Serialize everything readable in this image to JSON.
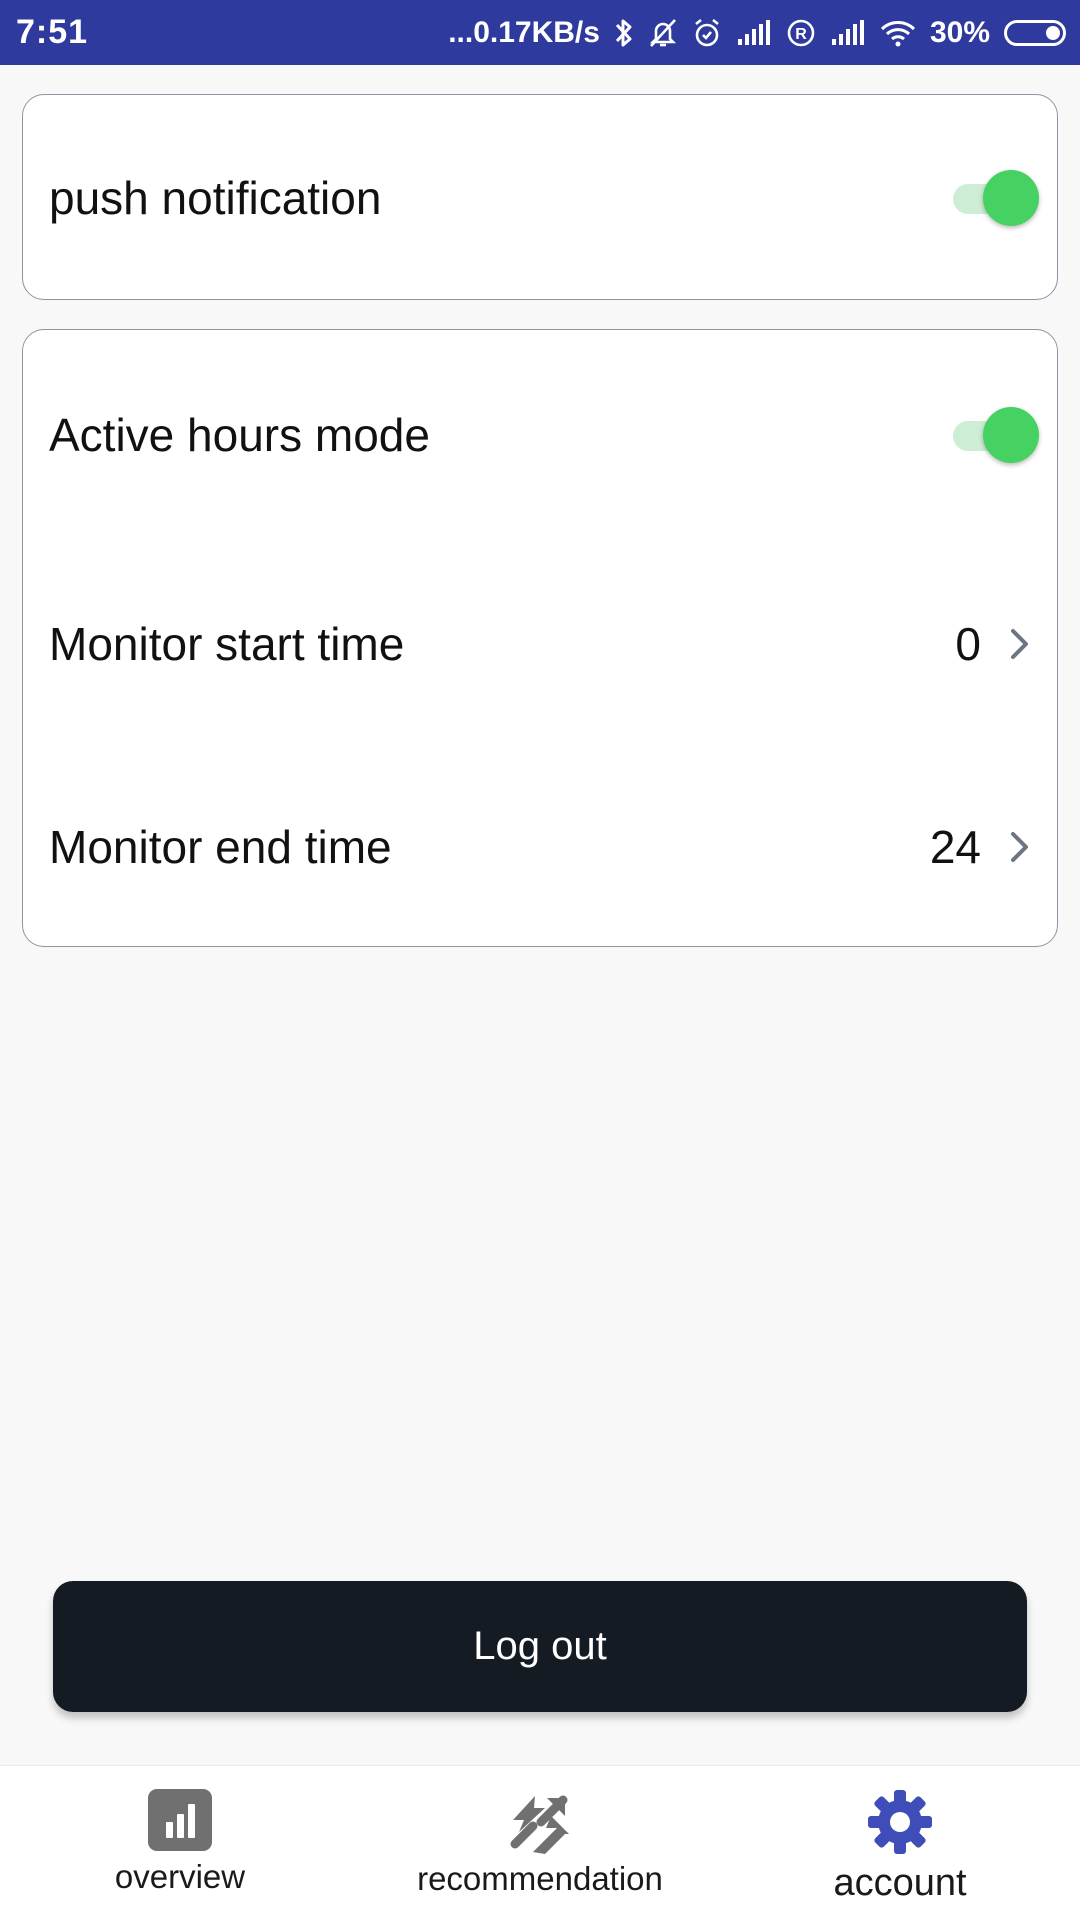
{
  "status_bar": {
    "time": "7:51",
    "network_speed": "...0.17KB/s",
    "battery_percent": "30%",
    "icons": [
      "bluetooth-icon",
      "notifications-off-icon",
      "alarm-icon",
      "signal-icon",
      "roaming-icon",
      "signal-icon",
      "wifi-icon",
      "battery-icon"
    ]
  },
  "settings": {
    "push_notification": {
      "label": "push notification",
      "enabled": true
    },
    "active_hours": {
      "label": "Active hours mode",
      "enabled": true,
      "start_label": "Monitor start time",
      "start_value": "0",
      "end_label": "Monitor end time",
      "end_value": "24"
    }
  },
  "logout": {
    "label": "Log out"
  },
  "nav": {
    "items": [
      {
        "label": "overview",
        "icon": "bar-chart-icon",
        "active": false
      },
      {
        "label": "recommendation",
        "icon": "swap-arrows-icon",
        "active": false
      },
      {
        "label": "account",
        "icon": "gear-icon",
        "active": true
      }
    ]
  },
  "colors": {
    "status_bar": "#2f3a9e",
    "toggle_on": "#45d263",
    "toggle_track": "#cdeed4",
    "logout_bg": "#151b23",
    "nav_active": "#3f4db8",
    "nav_inactive": "#707070"
  }
}
